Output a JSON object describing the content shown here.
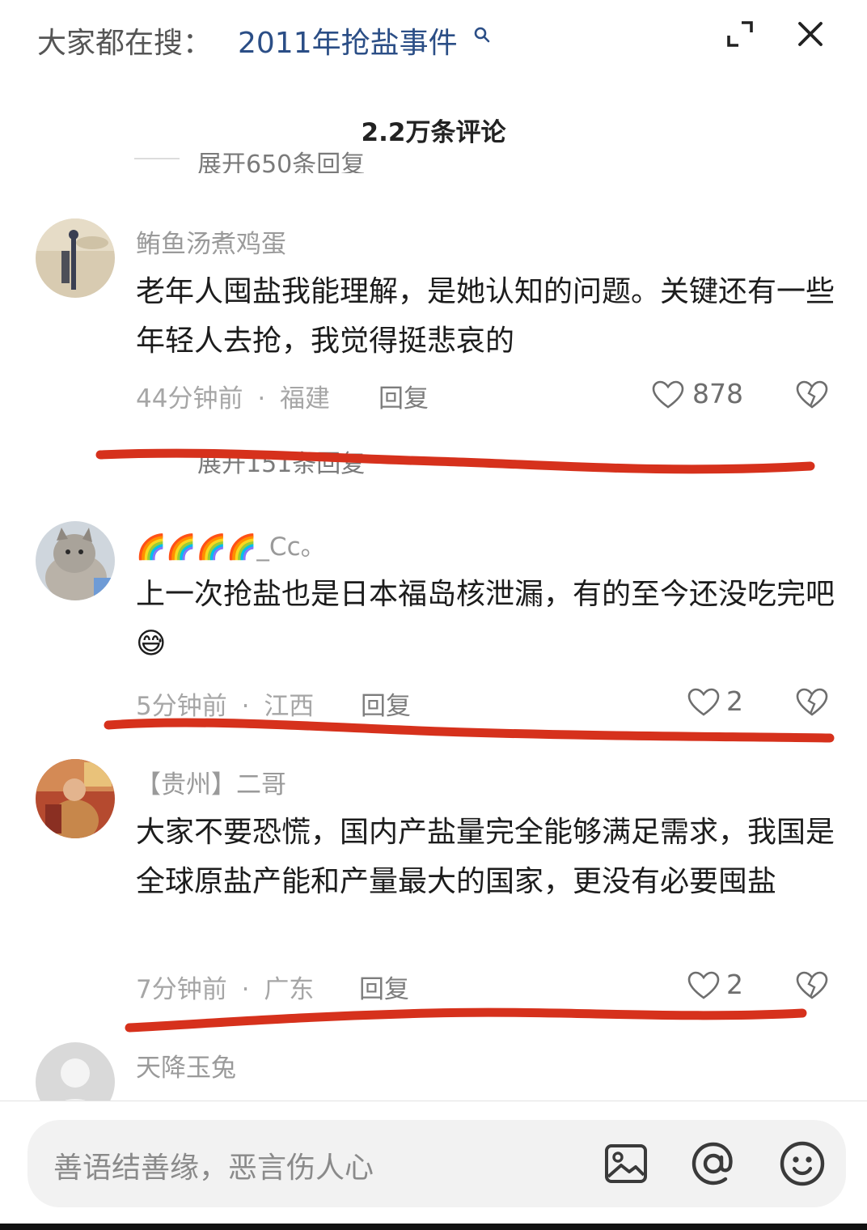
{
  "header": {
    "search_prefix": "大家都在搜：",
    "search_term": "2011年抢盐事件",
    "comment_count": "2.2万条评论"
  },
  "prev_expand": "展开650条回复",
  "comments": [
    {
      "username": "鲔鱼汤煮鸡蛋",
      "text": "老年人囤盐我能理解，是她认知的问题。关键还有一些年轻人去抢，我觉得挺悲哀的",
      "time": "44分钟前",
      "location": "福建",
      "reply_label": "回复",
      "likes": "878",
      "expand_replies": "展开151条回复"
    },
    {
      "username_emoji": "🌈🌈🌈🌈",
      "username": "_Cc。",
      "text": "上一次抢盐也是日本福岛核泄漏，有的至今还没吃完吧",
      "text_emoji": "😅",
      "time": "5分钟前",
      "location": "江西",
      "reply_label": "回复",
      "likes": "2"
    },
    {
      "username": "【贵州】二哥",
      "text": "大家不要恐慌，国内产盐量完全能够满足需求，我国是全球原盐产能和产量最大的国家，更没有必要囤盐",
      "time": "7分钟前",
      "location": "广东",
      "reply_label": "回复",
      "likes": "2"
    },
    {
      "username": "天降玉兔"
    }
  ],
  "meta_separator": "·",
  "input": {
    "placeholder": "善语结善缘，恶言伤人心"
  },
  "icons": {
    "search": "search-icon",
    "expand": "expand-icon",
    "close": "close-icon",
    "like": "heart-outline-icon",
    "dislike": "broken-heart-icon",
    "image": "image-icon",
    "mention": "at-icon",
    "emoji": "emoji-icon"
  },
  "colors": {
    "search_term": "#2b4e86",
    "annotation_line": "#d6311c",
    "input_bg": "#f2f2f2"
  }
}
